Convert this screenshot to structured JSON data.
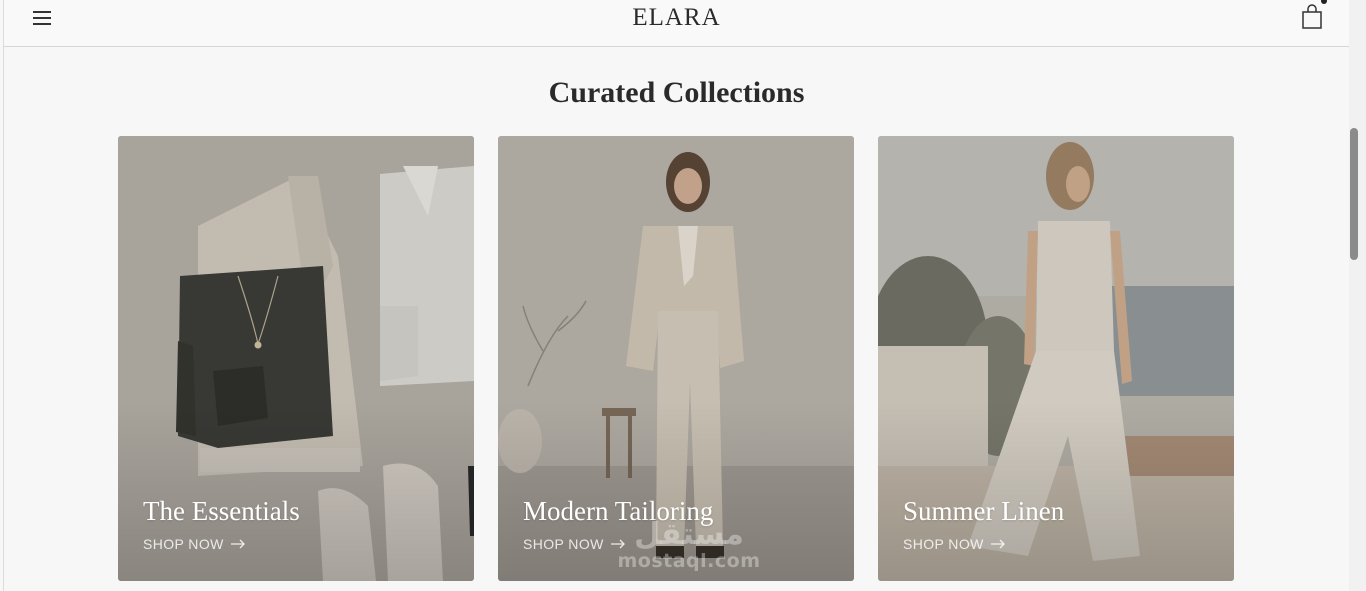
{
  "header": {
    "brand": "ELARA",
    "menu_icon": "hamburger-menu-icon",
    "bag_icon": "shopping-bag-icon"
  },
  "section": {
    "title": "Curated Collections"
  },
  "collections": [
    {
      "title": "The Essentials",
      "cta": "SHOP NOW",
      "cta_icon": "arrow-right-icon"
    },
    {
      "title": "Modern Tailoring",
      "cta": "SHOP NOW",
      "cta_icon": "arrow-right-icon"
    },
    {
      "title": "Summer Linen",
      "cta": "SHOP NOW",
      "cta_icon": "arrow-right-icon"
    }
  ],
  "watermark": {
    "arabic": "مستقل",
    "latin": "mostaql.com"
  },
  "colors": {
    "page_bg": "#f7f7f7",
    "text": "#2a2a2a",
    "card_text": "#ffffff"
  }
}
